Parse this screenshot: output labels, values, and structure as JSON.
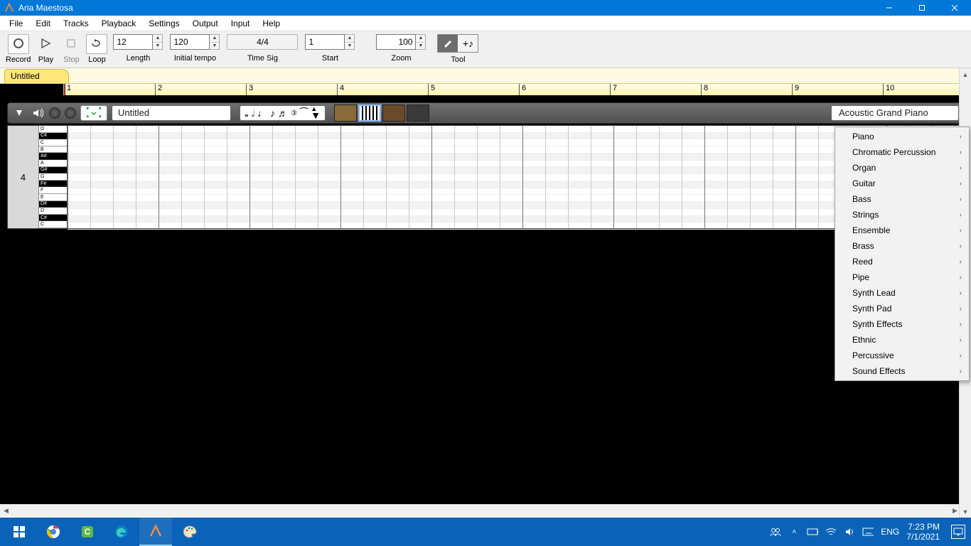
{
  "titlebar": {
    "app_name": "Aria Maestosa"
  },
  "menubar": {
    "items": [
      "File",
      "Edit",
      "Tracks",
      "Playback",
      "Settings",
      "Output",
      "Input",
      "Help"
    ]
  },
  "toolbar": {
    "record": "Record",
    "play": "Play",
    "stop": "Stop",
    "loop": "Loop",
    "length": {
      "label": "Length",
      "value": "12"
    },
    "tempo": {
      "label": "Initial tempo",
      "value": "120"
    },
    "timesig": {
      "label": "Time Sig",
      "value": "4/4"
    },
    "start": {
      "label": "Start",
      "value": "1"
    },
    "zoom": {
      "label": "Zoom",
      "value": "100"
    },
    "tool": {
      "label": "Tool"
    }
  },
  "tab": {
    "label": "Untitled"
  },
  "ruler": {
    "marks": [
      "1",
      "2",
      "3",
      "4",
      "5",
      "6",
      "7",
      "8",
      "9",
      "10"
    ]
  },
  "track": {
    "name": "Untitled",
    "octave": "4",
    "instrument": "Acoustic Grand Piano",
    "keys": [
      "D",
      "C#",
      "C",
      "B",
      "A#",
      "A",
      "G#",
      "G",
      "F#",
      "F",
      "E",
      "D#",
      "D",
      "C#",
      "C"
    ]
  },
  "instrument_menu": [
    "Piano",
    "Chromatic Percussion",
    "Organ",
    "Guitar",
    "Bass",
    "Strings",
    "Ensemble",
    "Brass",
    "Reed",
    "Pipe",
    "Synth Lead",
    "Synth Pad",
    "Synth Effects",
    "Ethnic",
    "Percussive",
    "Sound Effects"
  ],
  "systray": {
    "lang": "ENG",
    "time": "7:23 PM",
    "date": "7/1/2021"
  }
}
